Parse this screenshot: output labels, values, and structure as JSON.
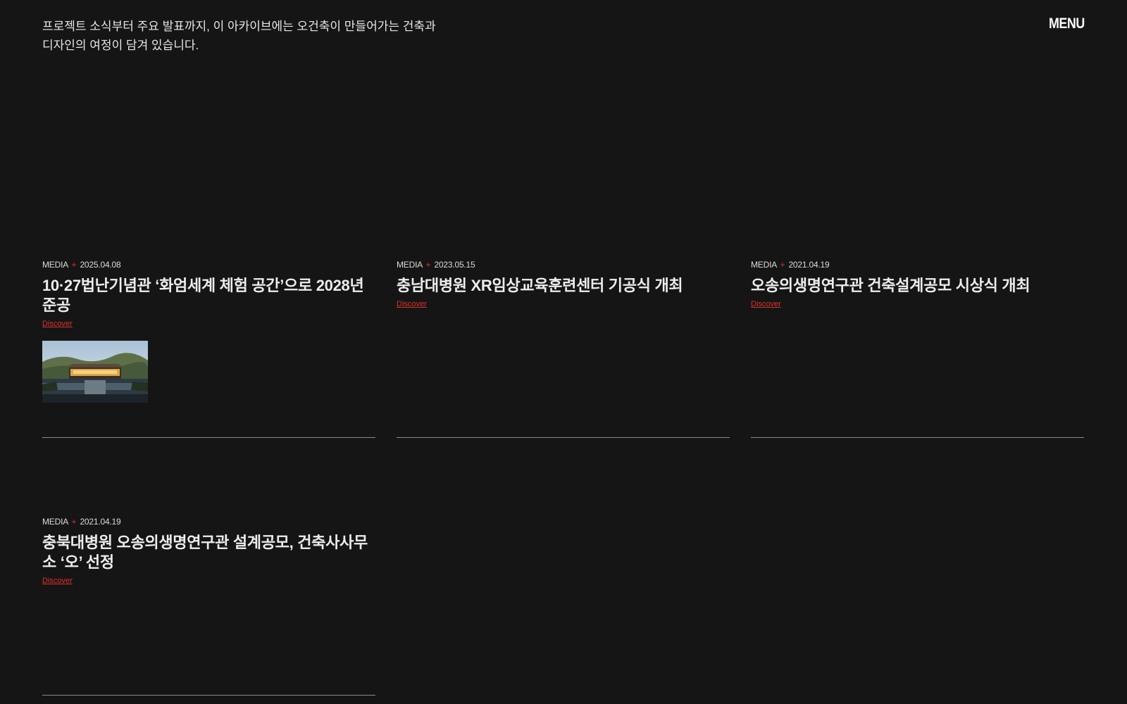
{
  "header": {
    "intro_line1": "프로젝트 소식부터 주요 발표까지, 이 아카이브에는 오건축이 만들어가는 건축과",
    "intro_line2": "디자인의 여정이 담겨 있습니다.",
    "menu_label": "MENU"
  },
  "cards": [
    {
      "category": "MEDIA",
      "separator": "+",
      "date": "2025.04.08",
      "title": "10·27법난기념관 ‘화엄세계 체험 공간’으로 2028년 준공",
      "link_label": "Discover"
    },
    {
      "category": "MEDIA",
      "separator": "+",
      "date": "2023.05.15",
      "title": "충남대병원 XR임상교육훈련센터 기공식 개최",
      "link_label": "Discover"
    },
    {
      "category": "MEDIA",
      "separator": "+",
      "date": "2021.04.19",
      "title": "오송의생명연구관 건축설계공모 시상식 개최",
      "link_label": "Discover"
    },
    {
      "category": "MEDIA",
      "separator": "+",
      "date": "2021.04.19",
      "title": "충북대병원 오송의생명연구관 설계공모, 건축사사무소 ‘오’ 선정",
      "link_label": "Discover"
    }
  ],
  "colors": {
    "background": "#151515",
    "accent": "#e0302a",
    "text": "#e8e8e8"
  }
}
